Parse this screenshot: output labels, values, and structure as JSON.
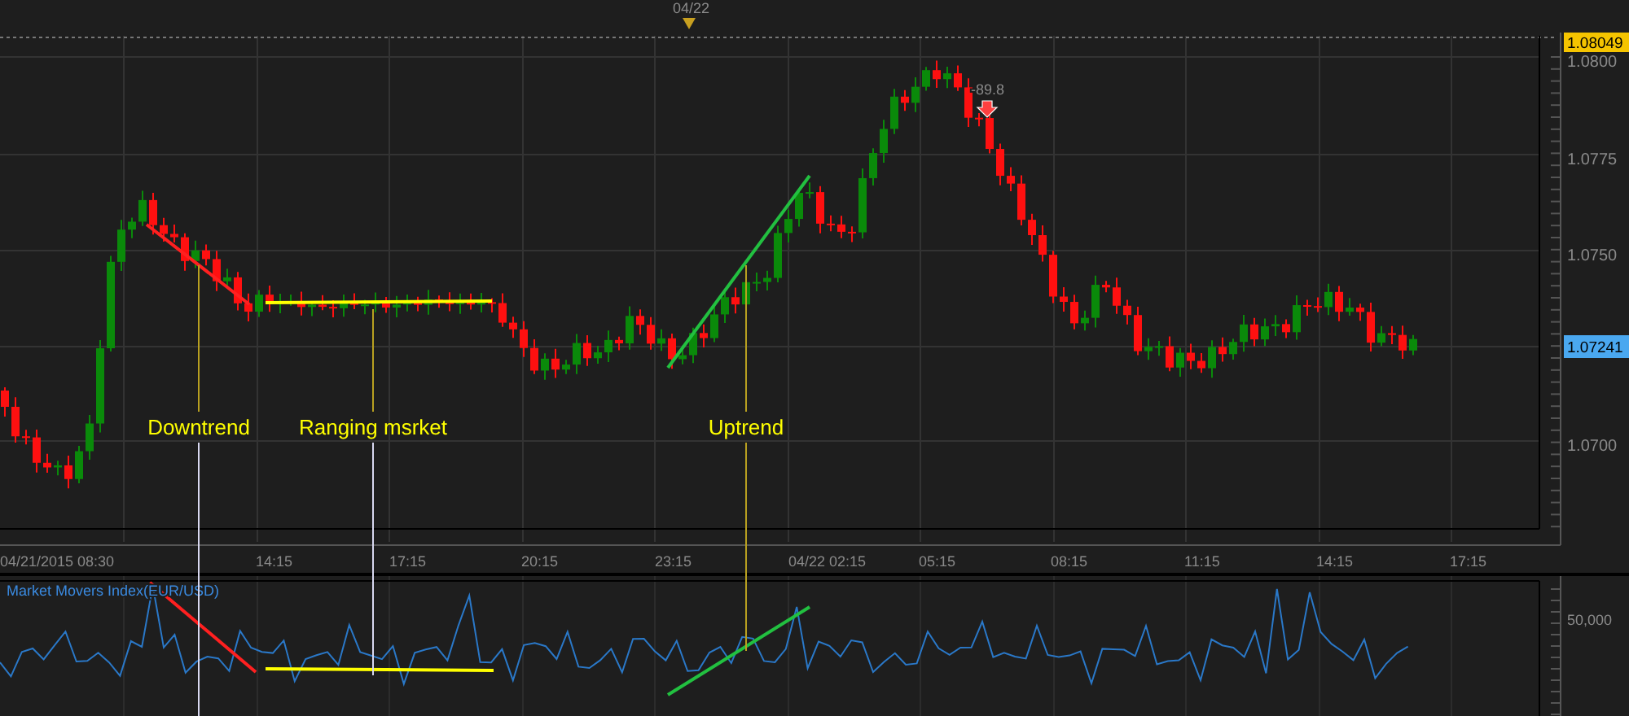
{
  "top_bar": {
    "date_marker": "04/22"
  },
  "price_chart": {
    "price_labels": [
      "1.0800",
      "1.0775",
      "1.0750",
      "1.0700"
    ],
    "high_tag": "1.08049",
    "last_tag": "1.07241",
    "marker_reading": "-89.8",
    "annotations": [
      {
        "label": "Downtrend",
        "color": "#ff2020"
      },
      {
        "label": "Ranging msrket",
        "color": "#ffff00"
      },
      {
        "label": "Uptrend",
        "color": "#22c040"
      }
    ]
  },
  "time_axis": [
    "04/21/2015 08:30",
    "14:15",
    "17:15",
    "20:15",
    "23:15",
    "04/22 02:15",
    "05:15",
    "08:15",
    "11:15",
    "14:15",
    "17:15"
  ],
  "indicator": {
    "title": "Market Movers Index(EUR/USD)",
    "axis_labels": [
      "50,000"
    ]
  }
}
